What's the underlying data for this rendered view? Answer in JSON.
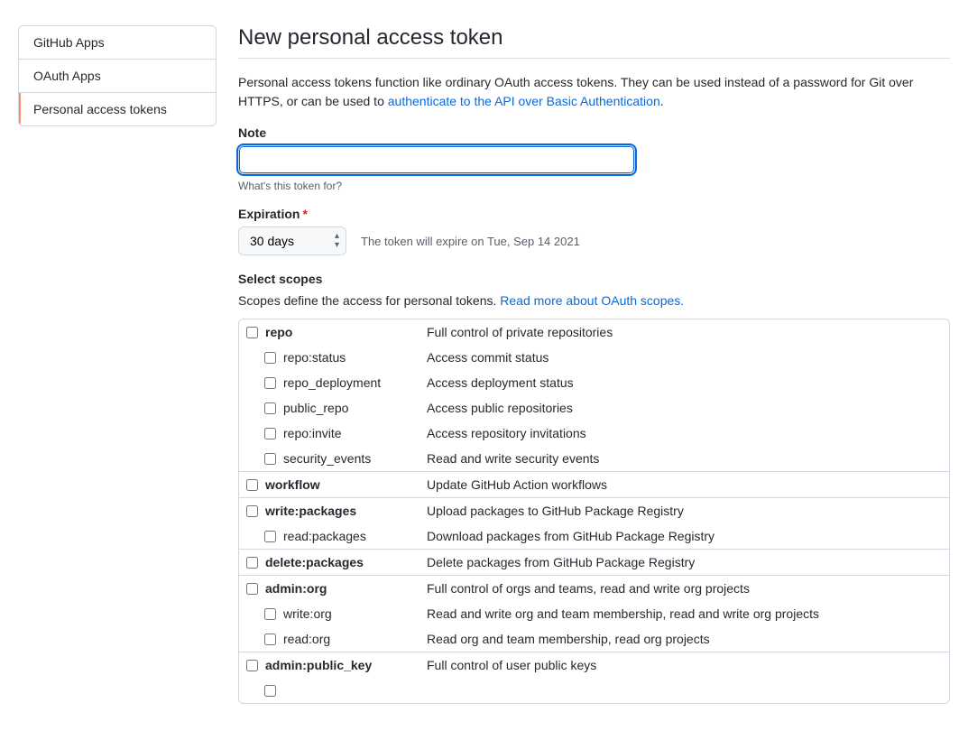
{
  "sidebar": {
    "items": [
      {
        "label": "GitHub Apps"
      },
      {
        "label": "OAuth Apps"
      },
      {
        "label": "Personal access tokens"
      }
    ]
  },
  "page": {
    "title": "New personal access token",
    "intro_pre": "Personal access tokens function like ordinary OAuth access tokens. They can be used instead of a password for Git over HTTPS, or can be used to ",
    "intro_link": "authenticate to the API over Basic Authentication",
    "intro_post": "."
  },
  "note": {
    "label": "Note",
    "value": "",
    "help": "What's this token for?"
  },
  "expiration": {
    "label": "Expiration",
    "required": "*",
    "selected": "30 days",
    "hint": "The token will expire on Tue, Sep 14 2021"
  },
  "scopes_section": {
    "heading": "Select scopes",
    "intro_pre": "Scopes define the access for personal tokens. ",
    "intro_link": "Read more about OAuth scopes.",
    "intro_post": ""
  },
  "scopes": {
    "repo": {
      "name": "repo",
      "desc": "Full control of private repositories"
    },
    "repo_status": {
      "name": "repo:status",
      "desc": "Access commit status"
    },
    "repo_deployment": {
      "name": "repo_deployment",
      "desc": "Access deployment status"
    },
    "public_repo": {
      "name": "public_repo",
      "desc": "Access public repositories"
    },
    "repo_invite": {
      "name": "repo:invite",
      "desc": "Access repository invitations"
    },
    "security_events": {
      "name": "security_events",
      "desc": "Read and write security events"
    },
    "workflow": {
      "name": "workflow",
      "desc": "Update GitHub Action workflows"
    },
    "write_packages": {
      "name": "write:packages",
      "desc": "Upload packages to GitHub Package Registry"
    },
    "read_packages": {
      "name": "read:packages",
      "desc": "Download packages from GitHub Package Registry"
    },
    "delete_packages": {
      "name": "delete:packages",
      "desc": "Delete packages from GitHub Package Registry"
    },
    "admin_org": {
      "name": "admin:org",
      "desc": "Full control of orgs and teams, read and write org projects"
    },
    "write_org": {
      "name": "write:org",
      "desc": "Read and write org and team membership, read and write org projects"
    },
    "read_org": {
      "name": "read:org",
      "desc": "Read org and team membership, read org projects"
    },
    "admin_public_key": {
      "name": "admin:public_key",
      "desc": "Full control of user public keys"
    }
  }
}
